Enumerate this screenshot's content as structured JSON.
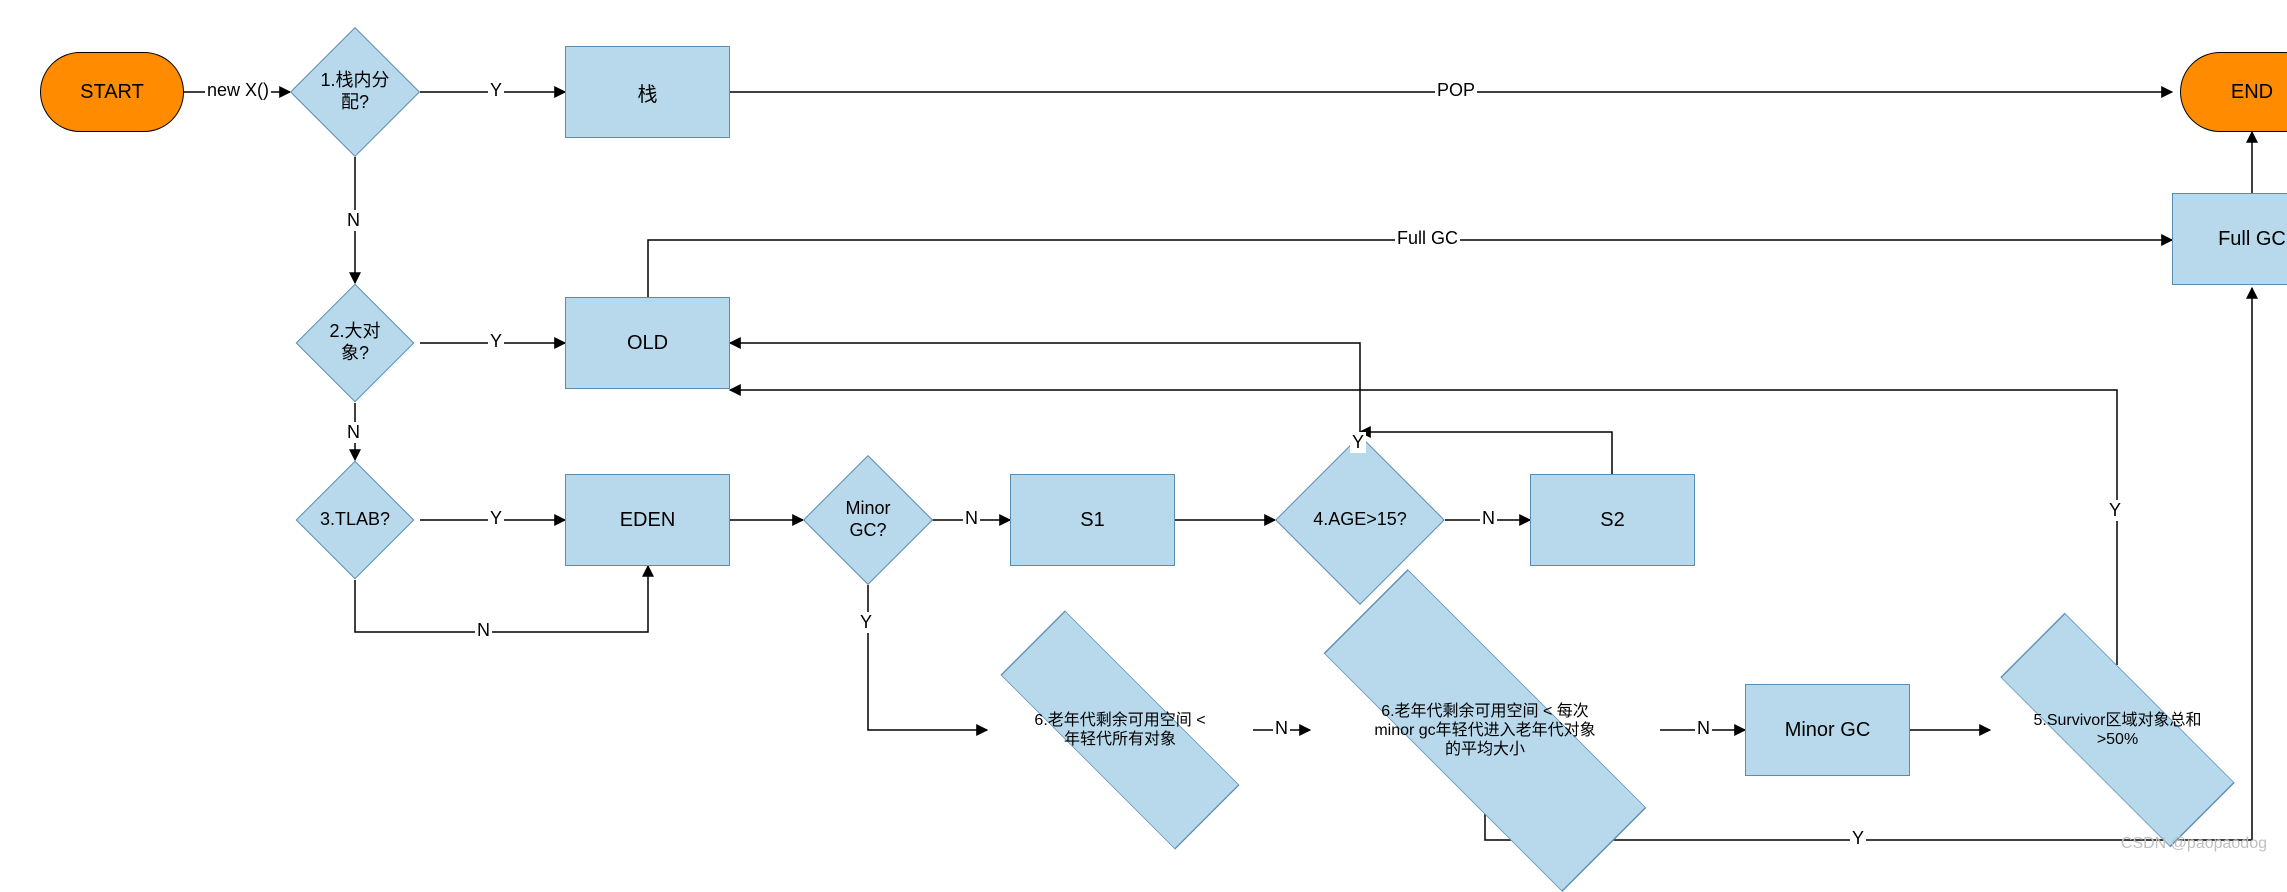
{
  "terminators": {
    "start": "START",
    "end": "END"
  },
  "decisions": {
    "d1": "1.栈内分配?",
    "d2": "2.大对象?",
    "d3": "3.TLAB?",
    "minorq": "Minor GC?",
    "age": "4.AGE>15?",
    "d6a": "6.老年代剩余可用空间 < 年轻代所有对象",
    "d6b": "6.老年代剩余可用空间 < 每次minor gc年轻代进入老年代对象的平均大小",
    "d5": "5.Survivor区域对象总和>50%"
  },
  "processes": {
    "stack": "栈",
    "old": "OLD",
    "eden": "EDEN",
    "s1": "S1",
    "s2": "S2",
    "minorgc": "Minor GC",
    "fullgc": "Full GC"
  },
  "edges": {
    "newx": "new X()",
    "y": "Y",
    "n": "N",
    "pop": "POP",
    "fullgc": "Full GC"
  },
  "watermark": "CSDN @paopaodog"
}
